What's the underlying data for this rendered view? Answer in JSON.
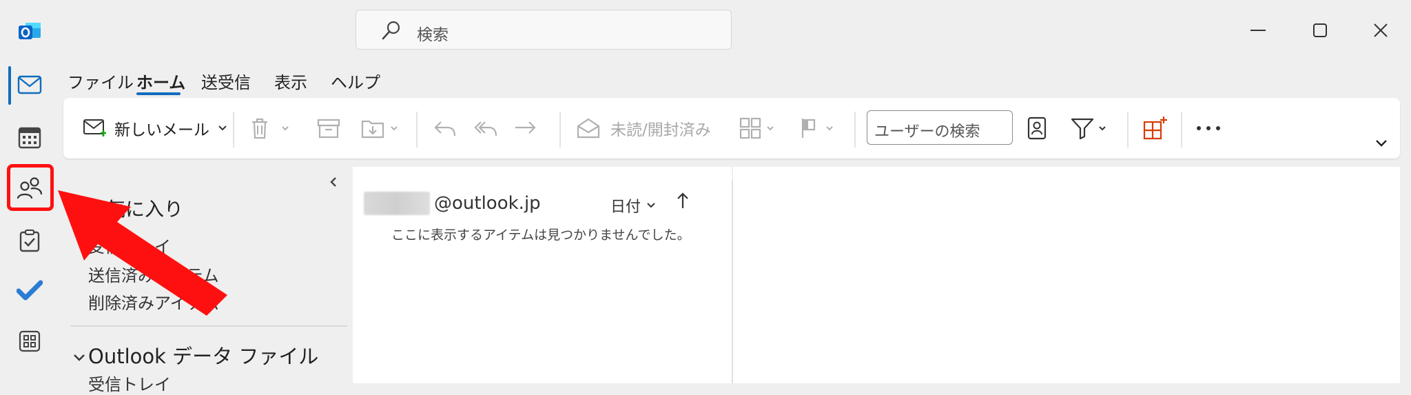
{
  "app": {
    "name": "Outlook"
  },
  "search": {
    "placeholder": "検索"
  },
  "menu": {
    "tabs": [
      {
        "label": "ファイル"
      },
      {
        "label": "ホーム"
      },
      {
        "label": "送受信"
      },
      {
        "label": "表示"
      },
      {
        "label": "ヘルプ"
      }
    ],
    "active_tab": "ホーム"
  },
  "ribbon": {
    "new_mail": "新しいメール",
    "mark_read": "未読/開封済み",
    "user_search": "ユーザーの検索"
  },
  "folders": {
    "favorites_title": "お気に入り",
    "favorites": [
      {
        "label": "受信トレイ"
      },
      {
        "label": "送信済みアイテム"
      },
      {
        "label": "削除済みアイテム"
      }
    ],
    "datafile_title": "Outlook データ ファイル",
    "datafile_items": [
      {
        "label": "受信トレイ"
      }
    ]
  },
  "message_list": {
    "account": "@outlook.jp",
    "sort_label": "日付",
    "empty_message": "ここに表示するアイテムは見つかりませんでした。"
  },
  "colors": {
    "accent": "#0f6cbd",
    "highlight": "#ff1010",
    "outlook_blue": "#0a64c8"
  }
}
